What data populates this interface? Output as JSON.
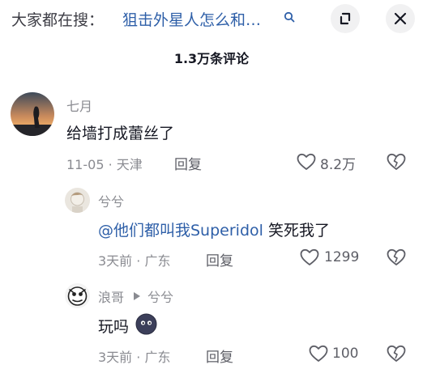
{
  "header": {
    "search_prefix": "大家都在搜：",
    "search_query": "狙击外星人怎么和…",
    "comment_count": "1.3万条评论"
  },
  "comments": [
    {
      "username": "七月",
      "text": "给墙打成蕾丝了",
      "meta": "11-05 · 天津",
      "reply_label": "回复",
      "likes": "8.2万"
    },
    {
      "username": "兮兮",
      "mention": "@他们都叫我Superidol",
      "text": " 笑死我了",
      "meta": "3天前 · 广东",
      "reply_label": "回复",
      "likes": "1299"
    },
    {
      "username": "浪哥",
      "reply_to": "兮兮",
      "text": "玩吗",
      "meta": "3天前 · 广东",
      "reply_label": "回复",
      "likes": "100"
    }
  ]
}
